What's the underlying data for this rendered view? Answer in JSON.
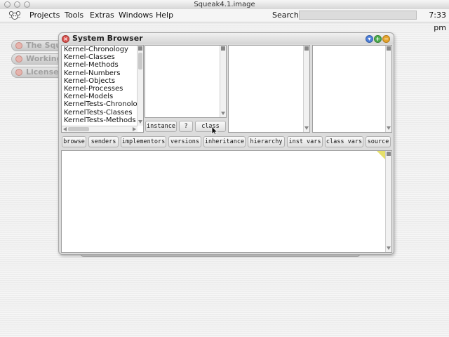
{
  "titlebar": {
    "title": "Squeak4.1.image"
  },
  "menubar": {
    "items": [
      "Projects",
      "Tools",
      "Extras",
      "Windows",
      "Help"
    ],
    "search_label": "Search:",
    "search_value": "",
    "clock": "7:33 pm"
  },
  "flaps": [
    "The Squ",
    "Working",
    "License"
  ],
  "browser": {
    "title": "System Browser",
    "categories": [
      "Kernel-Chronology",
      "Kernel-Classes",
      "Kernel-Methods",
      "Kernel-Numbers",
      "Kernel-Objects",
      "Kernel-Processes",
      "Kernel-Models",
      "KernelTests-Chronolo",
      "KernelTests-Classes",
      "KernelTests-Methods"
    ],
    "class_switch": {
      "instance": "instance",
      "help": "?",
      "class": "class"
    },
    "toolbar": {
      "browse": "browse",
      "senders": "senders",
      "implementors": "implementors",
      "versions": "versions",
      "inheritance": "inheritance",
      "hierarchy": "hierarchy",
      "inst_vars": "inst vars",
      "class_vars": "class vars",
      "source": "source"
    },
    "source_text": ""
  }
}
